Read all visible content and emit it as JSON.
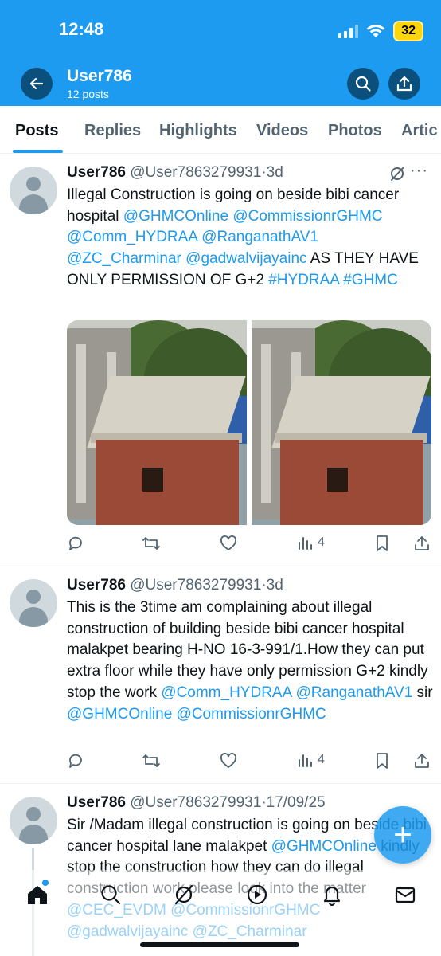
{
  "status_bar": {
    "time": "12:48",
    "battery": "32"
  },
  "header": {
    "name": "User786",
    "subtitle": "12 posts"
  },
  "tabs": [
    "Posts",
    "Replies",
    "Highlights",
    "Videos",
    "Photos",
    "Artic"
  ],
  "posts": [
    {
      "name": "User786",
      "handle": "@User7863279931",
      "separator": "·",
      "time": "3d",
      "text_segments": [
        {
          "t": "Illegal Construction is going on beside bibi cancer hospital ",
          "m": false
        },
        {
          "t": "@GHMCOnline",
          "m": true
        },
        {
          "t": " ",
          "m": false
        },
        {
          "t": "@CommissionrGHMC",
          "m": true
        },
        {
          "t": " ",
          "m": false
        },
        {
          "t": "@Comm_HYDRAA",
          "m": true
        },
        {
          "t": " ",
          "m": false
        },
        {
          "t": "@RanganathAV1",
          "m": true
        },
        {
          "t": " ",
          "m": false
        },
        {
          "t": "@ZC_Charminar",
          "m": true
        },
        {
          "t": " ",
          "m": false
        },
        {
          "t": "@gadwalvijayainc",
          "m": true
        },
        {
          "t": "  AS THEY HAVE ONLY PERMISSION OF G+2 ",
          "m": false
        },
        {
          "t": "#HYDRAA",
          "m": true
        },
        {
          "t": " ",
          "m": false
        },
        {
          "t": "#GHMC",
          "m": true
        }
      ],
      "views": "4"
    },
    {
      "name": "User786",
      "handle": "@User7863279931",
      "separator": "·",
      "time": "3d",
      "text_segments": [
        {
          "t": "This is the 3time am complaining about illegal construction of building beside bibi cancer hospital malakpet bearing H-NO 16-3-991/1.How they can put extra floor while they have only permission G+2 kindly stop the work ",
          "m": false
        },
        {
          "t": "@Comm_HYDRAA",
          "m": true
        },
        {
          "t": " ",
          "m": false
        },
        {
          "t": "@RanganathAV1",
          "m": true
        },
        {
          "t": "  sir ",
          "m": false
        },
        {
          "t": "@GHMCOnline",
          "m": true
        },
        {
          "t": " ",
          "m": false
        },
        {
          "t": "@CommissionrGHMC",
          "m": true
        }
      ],
      "views": "4"
    },
    {
      "name": "User786",
      "handle": "@User7863279931",
      "separator": "·",
      "time": "17/09/25",
      "text_segments": [
        {
          "t": "Sir /Madam illegal construction is going on beside bibi cancer hospital lane malakpet ",
          "m": false
        },
        {
          "t": "@GHMCOnline",
          "m": true
        },
        {
          "t": " kindly stop the construction how they can do illegal construction work please look into the matter ",
          "m": false
        },
        {
          "t": "@CEC_EVDM",
          "m": true
        },
        {
          "t": " ",
          "m": false
        },
        {
          "t": "@CommissionrGHMC",
          "m": true
        },
        {
          "t": " ",
          "m": false
        },
        {
          "t": "@gadwalvijayainc",
          "m": true
        },
        {
          "t": " ",
          "m": false
        },
        {
          "t": "@ZC_Charminar",
          "m": true
        }
      ]
    }
  ],
  "fab": {
    "label": "+"
  },
  "icons": [
    "back-arrow-icon",
    "search-icon",
    "share-icon",
    "grok-icon",
    "more-icon",
    "reply-icon",
    "retweet-icon",
    "like-icon",
    "views-icon",
    "bookmark-icon",
    "home-icon",
    "search-nav-icon",
    "grok-nav-icon",
    "video-icon",
    "bell-icon",
    "mail-icon"
  ],
  "colors": {
    "accent": "#1d9bf0",
    "text": "#0f1419",
    "muted": "#536471"
  }
}
